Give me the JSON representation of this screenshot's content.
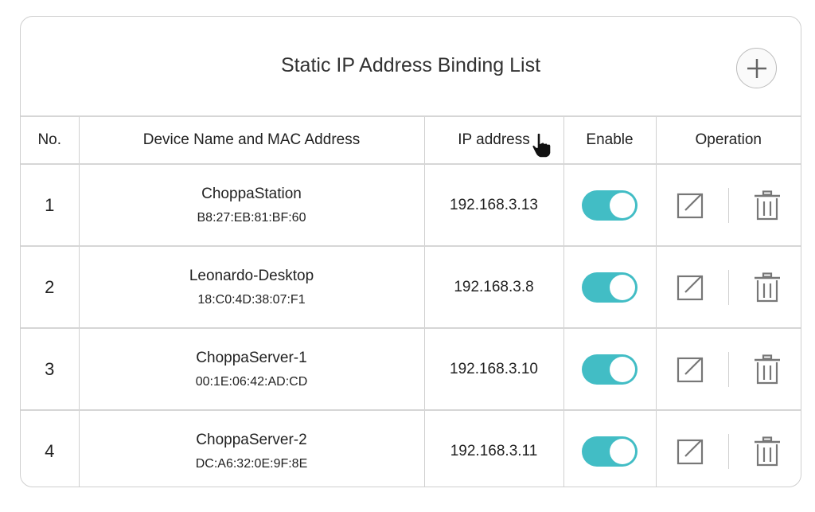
{
  "title": "Static IP Address Binding List",
  "add_button": {
    "icon": "plus-icon",
    "label": "Add"
  },
  "columns": [
    "No.",
    "Device Name and MAC Address",
    "IP address",
    "Enable",
    "Operation"
  ],
  "rows": [
    {
      "no": "1",
      "name": "ChoppaStation",
      "mac": "B8:27:EB:81:BF:60",
      "ip": "192.168.3.13",
      "enabled": true
    },
    {
      "no": "2",
      "name": "Leonardo-Desktop",
      "mac": "18:C0:4D:38:07:F1",
      "ip": "192.168.3.8",
      "enabled": true
    },
    {
      "no": "3",
      "name": "ChoppaServer-1",
      "mac": "00:1E:06:42:AD:CD",
      "ip": "192.168.3.10",
      "enabled": true
    },
    {
      "no": "4",
      "name": "ChoppaServer-2",
      "mac": "DC:A6:32:0E:9F:8E",
      "ip": "192.168.3.11",
      "enabled": true
    }
  ],
  "colors": {
    "toggle_on": "#42bdc5",
    "icon": "#777777",
    "border": "#d0d0d0"
  },
  "icons": {
    "edit": "edit-icon",
    "delete": "trash-icon",
    "cursor": "hand-pointer-icon"
  }
}
